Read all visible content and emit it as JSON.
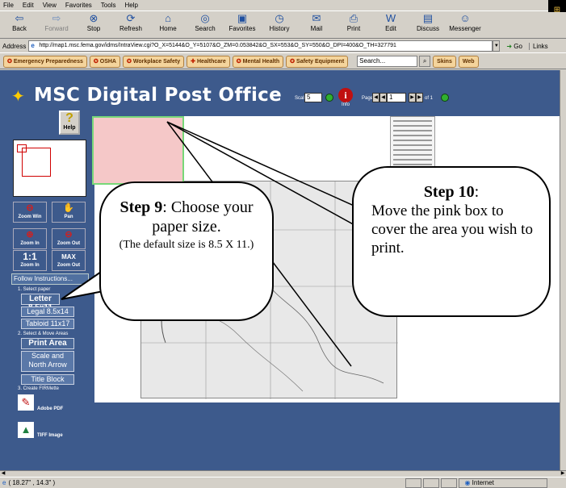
{
  "menu": {
    "items": [
      "File",
      "Edit",
      "View",
      "Favorites",
      "Tools",
      "Help"
    ]
  },
  "toolbar": {
    "buttons": [
      "Back",
      "Forward",
      "Stop",
      "Refresh",
      "Home",
      "Search",
      "Favorites",
      "History",
      "Mail",
      "Print",
      "Edit",
      "Discuss",
      "Messenger"
    ]
  },
  "address": {
    "label": "Address",
    "url": "http://map1.msc.fema.gov/idms/IntraView.cgi?O_X=5144&O_Y=5107&O_ZM=0.053842&O_SX=553&O_SY=550&O_DPI=400&O_TH=327791",
    "go": "Go",
    "links": "Links"
  },
  "linksbar": {
    "items": [
      "Emergency Preparedness",
      "OSHA",
      "Workplace Safety",
      "Healthcare",
      "Mental Health",
      "Safety Equipment"
    ],
    "search_value": "Search...",
    "skins": "Skins",
    "web": "Web"
  },
  "app": {
    "title": "MSC Digital Post Office",
    "scale_label": "Scale:",
    "scale_value": "5",
    "info_label": "Info",
    "page_label": "Page",
    "page_value": "1",
    "page_of": "of 1"
  },
  "sidebar": {
    "help": "Help",
    "tools": {
      "zoom_win": "Zoom Win",
      "pan": "Pan",
      "zoom_in": "Zoom In",
      "zoom_out": "Zoom Out",
      "one_to_one": "1:1",
      "max": "MAX",
      "zoom_in2": "Zoom In",
      "zoom_out2": "Zoom Out"
    },
    "follow": "Follow Instructions...",
    "step1": "1. Select paper",
    "letter": "Letter 8.5x11",
    "legal": "Legal 8.5x14",
    "tabloid": "Tabloid 11x17",
    "step2": "2. Select & Move Areas",
    "print_area": "Print Area",
    "scale_north_1": "Scale and",
    "scale_north_2": "North Arrow",
    "title_block": "Title Block",
    "step3": "3. Create FIRMette",
    "pdf": "Adobe PDF",
    "tiff": "TIFF Image"
  },
  "callout9": {
    "bold": "Step 9",
    "text1": ": Choose your paper size.",
    "text2": "(The default size is 8.5 X 11.)"
  },
  "callout10": {
    "bold": "Step 10",
    "colon": ":",
    "text": "Move the pink box to cover the area you wish to print."
  },
  "status": {
    "coords": "( 18.27\" , 14.3\" )",
    "zone": "Internet"
  }
}
